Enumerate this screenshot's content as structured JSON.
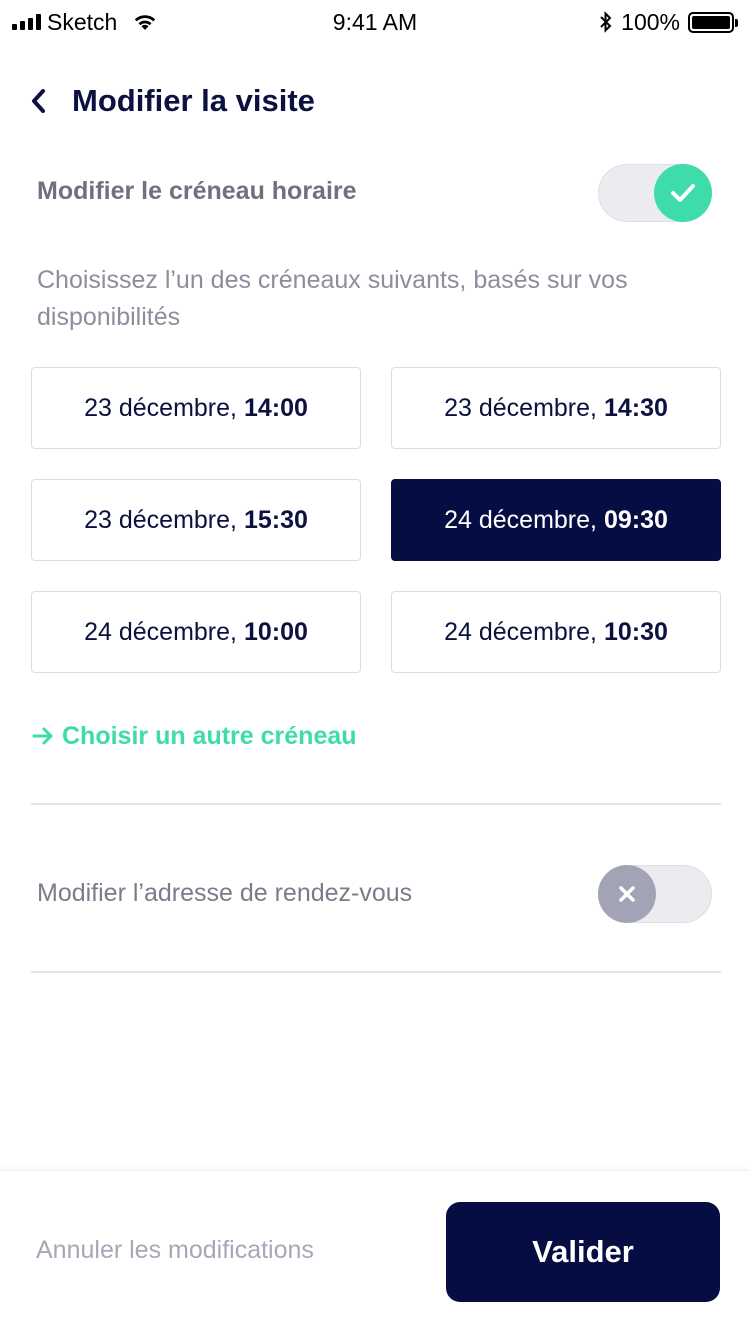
{
  "status_bar": {
    "carrier": "Sketch",
    "time": "9:41 AM",
    "battery": "100%",
    "icons": [
      "signal-icon",
      "wifi-icon",
      "bluetooth-icon",
      "battery-icon"
    ]
  },
  "header": {
    "back_icon": "chevron-left-icon",
    "title": "Modifier la visite"
  },
  "slot_section": {
    "label": "Modifier le créneau horaire",
    "toggle_on": true,
    "description": "Choisissez l’un des créneaux suivants, basés sur vos disponibilités",
    "slots": [
      {
        "date": "23 décembre, ",
        "time": "14:00",
        "selected": false
      },
      {
        "date": "23 décembre, ",
        "time": "14:30",
        "selected": false
      },
      {
        "date": "23 décembre, ",
        "time": "15:30",
        "selected": false
      },
      {
        "date": "24 décembre, ",
        "time": "09:30",
        "selected": true
      },
      {
        "date": "24 décembre, ",
        "time": "10:00",
        "selected": false
      },
      {
        "date": "24 décembre, ",
        "time": "10:30",
        "selected": false
      }
    ],
    "other_slot_label": "Choisir un autre créneau"
  },
  "address_section": {
    "label": "Modifier l’adresse de rendez-vous",
    "toggle_on": false
  },
  "footer": {
    "cancel_label": "Annuler les modifications",
    "validate_label": "Valider"
  },
  "colors": {
    "navy": "#060d42",
    "accent_green": "#3ddcaa",
    "muted_text": "#8d8e9c",
    "toggle_off_knob": "#a3a3b6"
  }
}
